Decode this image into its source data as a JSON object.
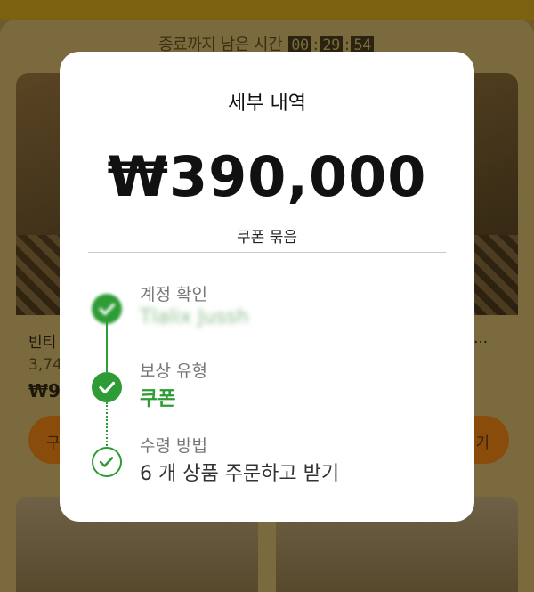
{
  "timer": {
    "label": "종료까지 남은 시간",
    "hours": "00",
    "sep": ":",
    "minutes": "29",
    "seconds": "54"
  },
  "background_cards": {
    "left_title": "빈티",
    "left_sub": "3,74",
    "left_price": "₩9",
    "left_button": "구",
    "right_title": "...",
    "right_button": "기"
  },
  "modal": {
    "title": "세부 내역",
    "amount": "₩390,000",
    "bundle_label": "쿠폰 묶음",
    "steps": [
      {
        "label": "계정 확인",
        "value": "Tlalix Jussh",
        "icon": "check-icon",
        "status": "done"
      },
      {
        "label": "보상 유형",
        "value": "쿠폰",
        "icon": "check-icon",
        "status": "done"
      },
      {
        "label": "수령 방법",
        "value": "6 개 상품 주문하고 받기",
        "icon": "check-outline-icon",
        "status": "pending"
      }
    ]
  },
  "colors": {
    "accent_green": "#2e9c35",
    "overlay_background": "#7a6a3d",
    "modal_background": "#ffffff"
  }
}
